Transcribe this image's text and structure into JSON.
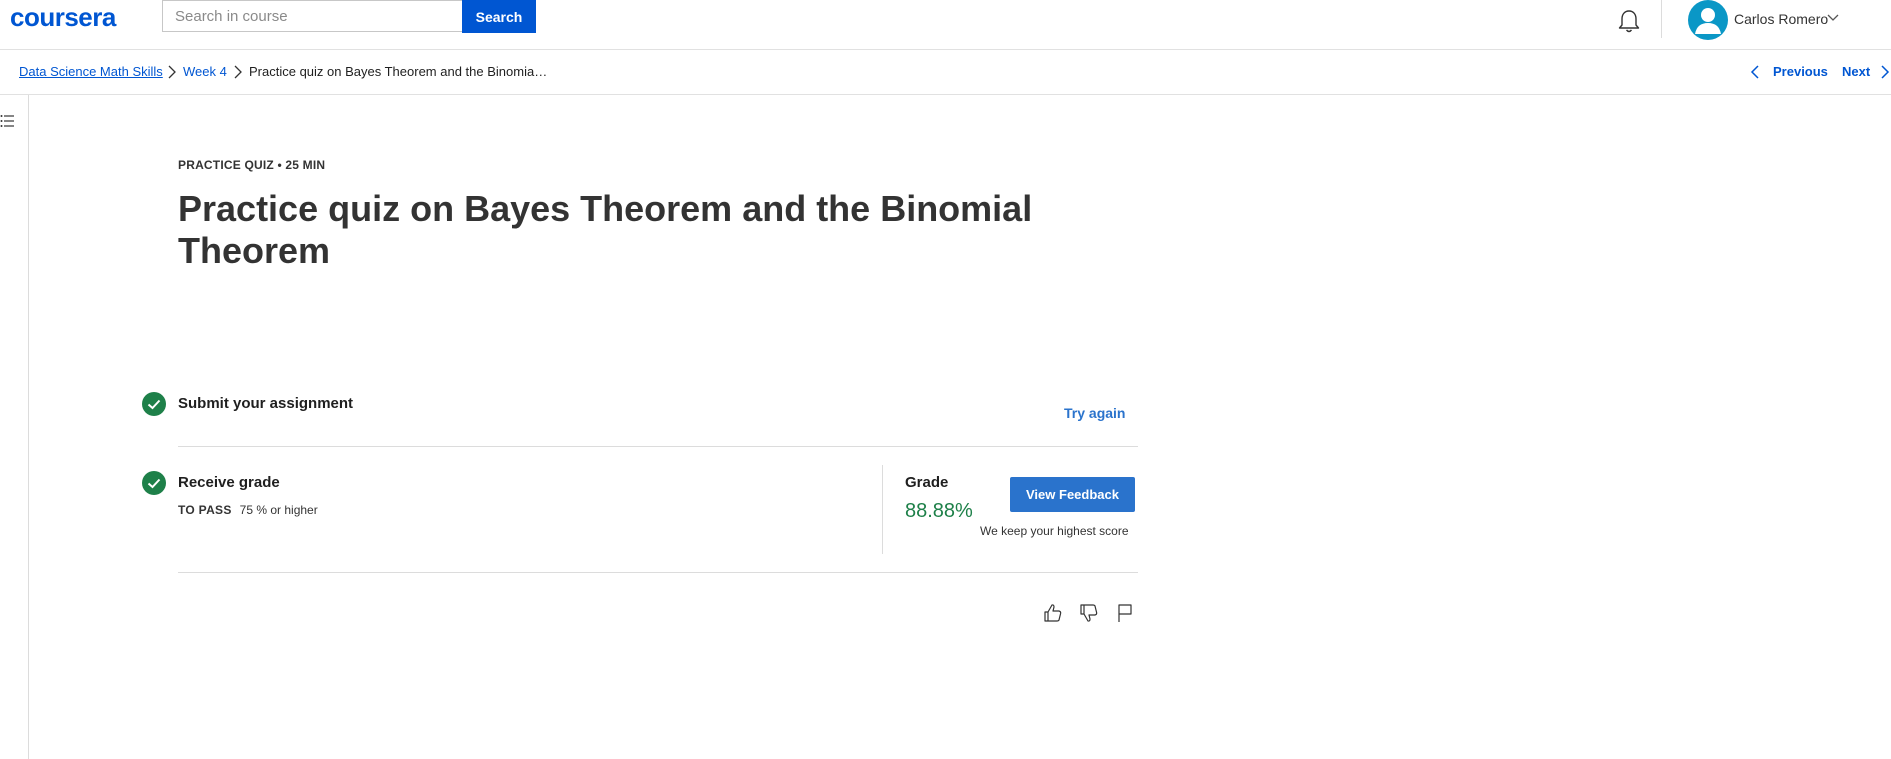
{
  "header": {
    "logo": "coursera",
    "search": {
      "placeholder": "Search in course",
      "value": "",
      "button_label": "Search"
    },
    "user": {
      "name": "Carlos Romero"
    },
    "icons": {
      "notifications": "bell-icon",
      "avatar": "user-avatar-icon",
      "menu": "chevron-down-icon"
    }
  },
  "breadcrumb": {
    "items": [
      "Data Science Math Skills",
      "Week 4",
      "Practice quiz on Bayes Theorem and the Binomia…"
    ],
    "previous_label": "Previous",
    "next_label": "Next"
  },
  "sidebar": {
    "toggle_icon": "list-icon"
  },
  "quiz": {
    "eyebrow": "PRACTICE QUIZ • 25 MIN",
    "title": "Practice quiz on Bayes Theorem and the Binomial Theorem",
    "steps": {
      "submit": {
        "title": "Submit your assignment",
        "action_label": "Try again"
      },
      "grade": {
        "title": "Receive grade",
        "to_pass_label": "TO PASS",
        "to_pass_value": "75 % or higher",
        "grade_label": "Grade",
        "grade_value": "88.88%",
        "feedback_button": "View Feedback",
        "note": "We keep your highest score"
      }
    }
  },
  "feedback": {
    "icons": [
      "thumbs-up-icon",
      "thumbs-down-icon",
      "flag-icon"
    ]
  },
  "colors": {
    "brand": "#0056d2",
    "link": "#2a73cc",
    "success": "#1e8049",
    "divider": "#dcdcdc"
  }
}
